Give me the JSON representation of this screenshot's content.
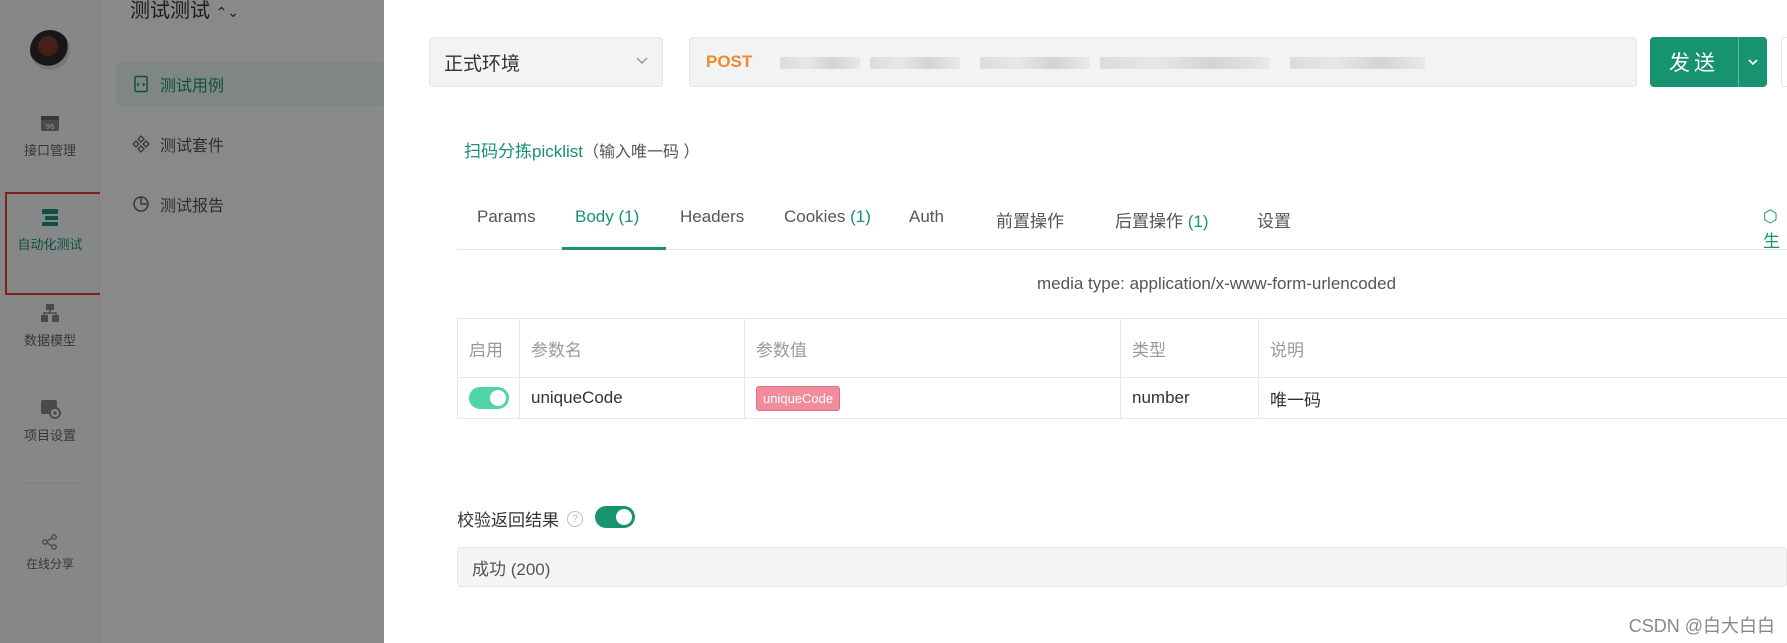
{
  "sidebar": {
    "items": [
      {
        "label": "接口管理",
        "icon": "api-box-icon",
        "active": false
      },
      {
        "label": "自动化测试",
        "icon": "automation-icon",
        "active": true
      },
      {
        "label": "数据模型",
        "icon": "data-model-icon",
        "active": false
      },
      {
        "label": "项目设置",
        "icon": "project-settings-icon",
        "active": false
      }
    ],
    "share_label": "在线分享"
  },
  "subnav": {
    "title": "测试测试",
    "items": [
      {
        "label": "测试用例",
        "icon": "test-case-icon",
        "active": true
      },
      {
        "label": "测试套件",
        "icon": "test-suite-icon",
        "active": false
      },
      {
        "label": "测试报告",
        "icon": "test-report-icon",
        "active": false
      }
    ]
  },
  "request": {
    "environment": "正式环境",
    "method": "POST",
    "send_label": "发送"
  },
  "case": {
    "name": "扫码分拣picklist",
    "description": "（输入唯一码 ）"
  },
  "tabs": [
    {
      "label": "Params",
      "count": ""
    },
    {
      "label": "Body",
      "count": " (1)"
    },
    {
      "label": "Headers",
      "count": ""
    },
    {
      "label": "Cookies",
      "count": " (1)"
    },
    {
      "label": "Auth",
      "count": ""
    },
    {
      "label": "前置操作",
      "count": ""
    },
    {
      "label": "后置操作",
      "count": " (1)"
    },
    {
      "label": "设置",
      "count": ""
    }
  ],
  "active_tab": "Body",
  "tabs_right_text": "生",
  "body": {
    "media_type": "media type: application/x-www-form-urlencoded",
    "columns": [
      "启用",
      "参数名",
      "参数值",
      "类型",
      "说明"
    ],
    "rows": [
      {
        "enabled": true,
        "name": "uniqueCode",
        "value": "uniqueCode",
        "type": "number",
        "note": "唯一码"
      }
    ]
  },
  "validation": {
    "label": "校验返回结果",
    "help": "?",
    "enabled": true,
    "response": "成功 (200)"
  },
  "watermark": "CSDN @白大白白",
  "colors": {
    "accent": "#17936f",
    "method": "#f08a2c",
    "highlight_box": "#e0403a",
    "variable_tag": "#f08c9b"
  }
}
